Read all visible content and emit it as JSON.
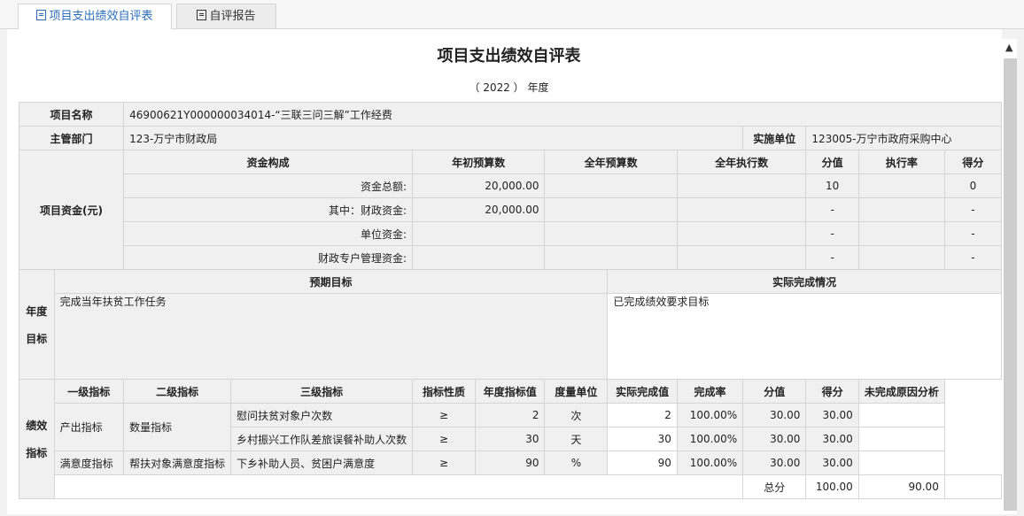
{
  "tabs": [
    {
      "label": "项目支出绩效自评表",
      "icon": "form-icon"
    },
    {
      "label": "自评报告",
      "icon": "report-icon"
    }
  ],
  "title": "项目支出绩效自评表",
  "year": "（ 2022 ） 年度",
  "project": {
    "name_label": "项目名称",
    "name_value": "46900621Y000000034014-“三联三问三解”工作经费",
    "dept_label": "主管部门",
    "dept_value": "123-万宁市财政局",
    "unit_label": "实施单位",
    "unit_value": "123005-万宁市政府采购中心"
  },
  "funds": {
    "label": "项目资金(元)",
    "headers": [
      "资金构成",
      "年初预算数",
      "全年预算数",
      "全年执行数",
      "分值",
      "执行率",
      "得分"
    ],
    "rows": [
      [
        "资金总额:",
        "20,000.00",
        "",
        "",
        "10",
        "",
        "0"
      ],
      [
        "其中：财政资金:",
        "20,000.00",
        "",
        "",
        "-",
        "",
        "-"
      ],
      [
        "单位资金:",
        "",
        "",
        "",
        "-",
        "",
        "-"
      ],
      [
        "财政专户管理资金:",
        "",
        "",
        "",
        "-",
        "",
        "-"
      ]
    ]
  },
  "goals": {
    "label_line1": "年度",
    "label_line2": "目标",
    "expected_header": "预期目标",
    "actual_header": "实际完成情况",
    "expected": "完成当年扶贫工作任务",
    "actual": "已完成绩效要求目标"
  },
  "indicators": {
    "label_line1": "绩效",
    "label_line2": "指标",
    "headers": [
      "一级指标",
      "二级指标",
      "三级指标",
      "指标性质",
      "年度指标值",
      "度量单位",
      "实际完成值",
      "完成率",
      "分值",
      "得分",
      "未完成原因分析"
    ],
    "groups": [
      {
        "level1": "产出指标",
        "level2": "数量指标",
        "rows": [
          {
            "level3": "慰问扶贫对象户次数",
            "nature": "≥",
            "target": "2",
            "unit": "次",
            "actual": "2",
            "rate": "100.00%",
            "score": "30.00",
            "got": "30.00",
            "reason": ""
          },
          {
            "level3": "乡村振兴工作队差旅误餐补助人次数",
            "nature": "≥",
            "target": "30",
            "unit": "天",
            "actual": "30",
            "rate": "100.00%",
            "score": "30.00",
            "got": "30.00",
            "reason": ""
          }
        ]
      },
      {
        "level1": "满意度指标",
        "level2": "帮扶对象满意度指标",
        "rows": [
          {
            "level3": "下乡补助人员、贫困户满意度",
            "nature": "≥",
            "target": "90",
            "unit": "%",
            "actual": "90",
            "rate": "100.00%",
            "score": "30.00",
            "got": "30.00",
            "reason": ""
          }
        ]
      }
    ],
    "total_label": "总分",
    "total_score": "100.00",
    "total_got": "90.00"
  }
}
